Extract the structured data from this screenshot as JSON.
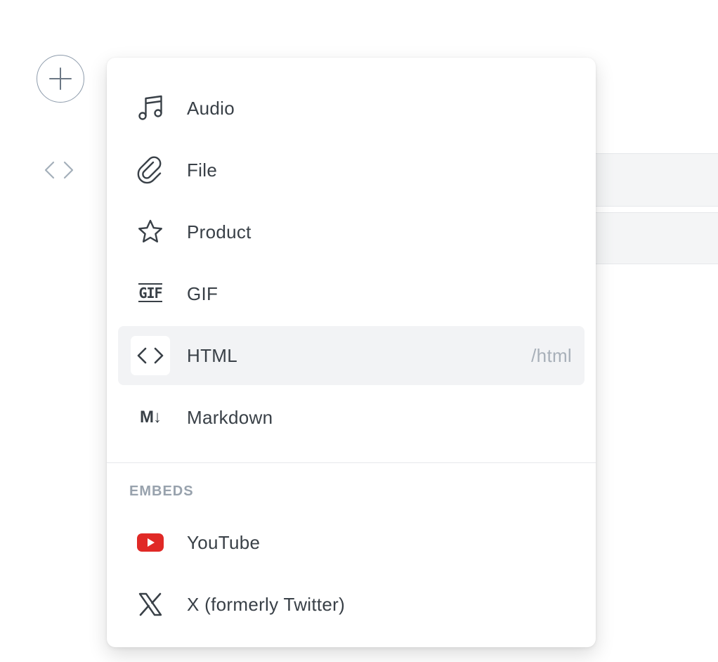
{
  "menu": {
    "items": [
      {
        "label": "Audio",
        "icon": "music-note-icon"
      },
      {
        "label": "File",
        "icon": "paperclip-icon"
      },
      {
        "label": "Product",
        "icon": "star-icon"
      },
      {
        "label": "GIF",
        "icon": "gif-icon"
      },
      {
        "label": "HTML",
        "icon": "code-icon",
        "shortcut": "/html",
        "active": true
      },
      {
        "label": "Markdown",
        "icon": "markdown-icon"
      }
    ],
    "embeds_title": "EMBEDS",
    "embeds": [
      {
        "label": "YouTube",
        "icon": "youtube-icon"
      },
      {
        "label": "X (formerly Twitter)",
        "icon": "x-logo-icon"
      }
    ]
  },
  "icon_glyphs": {
    "gif": "GIF",
    "markdown": "M↓"
  },
  "colors": {
    "youtube_red": "#e02926",
    "active_bg": "#f2f3f5",
    "text": "#394047",
    "muted": "#a8b0b9"
  }
}
